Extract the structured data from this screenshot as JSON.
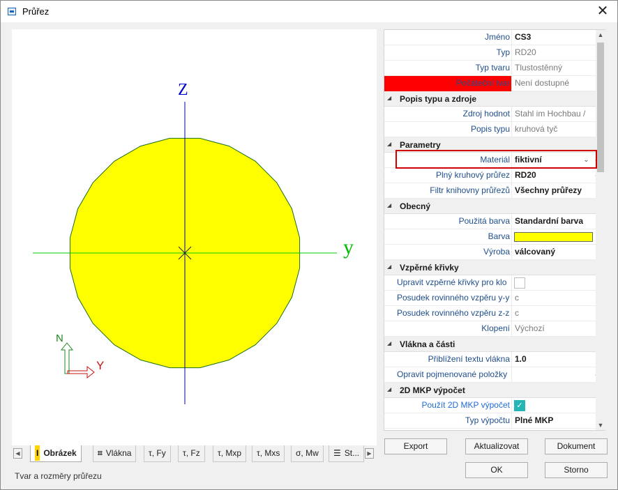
{
  "window": {
    "title": "Průřez",
    "close_glyph": "✕"
  },
  "drawing": {
    "axis_z_label": "Z",
    "axis_y_label": "y",
    "lcs_n_label": "N",
    "lcs_y_label": "Y",
    "fill_color": "#ffff00",
    "outline_color": "#1a6b1a"
  },
  "tabs": [
    {
      "label": "Obrázek",
      "icon": "I",
      "icon_name": "profile-icon"
    },
    {
      "label": "Vlákna",
      "icon": "⌗",
      "icon_name": "fibers-icon"
    },
    {
      "label": "τ, Fy"
    },
    {
      "label": "τ, Fz"
    },
    {
      "label": "τ, Mxp"
    },
    {
      "label": "τ, Mxs"
    },
    {
      "label": "σ, Mw"
    },
    {
      "label": "St...",
      "icon": "☰",
      "icon_name": "list-icon"
    }
  ],
  "tab_scroll": {
    "left": "◀",
    "right": "▶"
  },
  "status": "Tvar a rozměry průřezu",
  "props": {
    "name_label": "Jméno",
    "name_value": "CS3",
    "type_label": "Typ",
    "type_value": "RD20",
    "shape_label": "Typ tvaru",
    "shape_value": "Tlustostěnný",
    "initial_label": "Počáteční tvar",
    "initial_value": "Není dostupné",
    "sec1": "Popis typu a zdroje",
    "source_label": "Zdroj hodnot",
    "source_value": "Stahl im Hochbau /",
    "desc_label": "Popis typu",
    "desc_value": "kruhová tyč",
    "sec2": "Parametry",
    "material_label": "Materiál",
    "material_value": "fiktivní",
    "solid_label": "Plný kruhový průřez",
    "solid_value": "RD20",
    "filter_label": "Filtr knihovny průřezů",
    "filter_value": "Všechny průřezy",
    "sec3": "Obecný",
    "usecolor_label": "Použitá barva",
    "usecolor_value": "Standardní barva",
    "color_label": "Barva",
    "color_value": "#ffff00",
    "fab_label": "Výroba",
    "fab_value": "válcovaný",
    "sec4": "Vzpěrné křivky",
    "modify_label": "Upravit vzpěrné křivky pro klo",
    "yy_label": "Posudek rovinného vzpěru y-y",
    "yy_value": "c",
    "zz_label": "Posudek rovinného vzpěru z-z",
    "zz_value": "c",
    "ltb_label": "Klopení",
    "ltb_value": "Výchozí",
    "sec5": "Vlákna a části",
    "approx_label": "Přiblížení textu vlákna",
    "approx_value": "1.0",
    "named_label": "Opravit pojmenované položky",
    "sec6": "2D MKP výpočet",
    "use2d_label": "Použít 2D MKP výpočet",
    "calc_label": "Typ výpočtu",
    "calc_value": "Plné MKP",
    "dropdown_glyph": "⌄",
    "ellipsis_glyph": "...",
    "section_glyph": "◢",
    "check_glyph": "✓"
  },
  "scroll": {
    "up": "▲",
    "down": "▼"
  },
  "buttons": {
    "export": "Export",
    "refresh": "Aktualizovat",
    "document": "Dokument",
    "ok": "OK",
    "cancel": "Storno"
  }
}
